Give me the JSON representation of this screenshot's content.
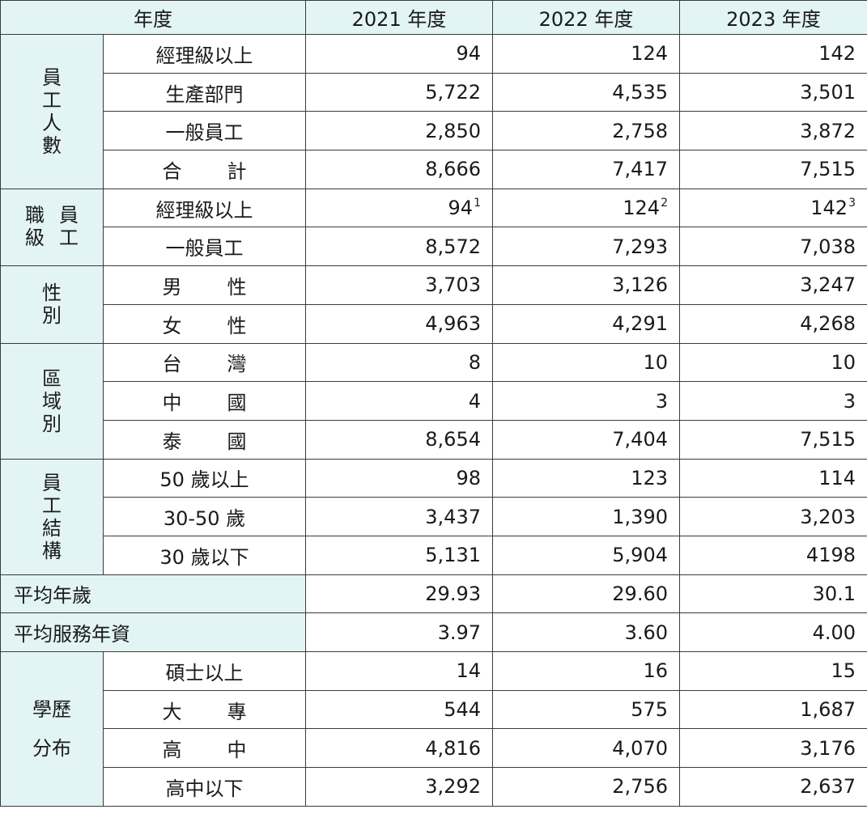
{
  "header": {
    "label": "年度",
    "y2021": "2021 年度",
    "y2022": "2022 年度",
    "y2023": "2023 年度"
  },
  "headcount": {
    "category": "員工人數",
    "rows": [
      {
        "label": "經理級以上",
        "v2021": "94",
        "v2022": "124",
        "v2023": "142"
      },
      {
        "label": "生產部門",
        "v2021": "5,722",
        "v2022": "4,535",
        "v2023": "3,501"
      },
      {
        "label": "一般員工",
        "v2021": "2,850",
        "v2022": "2,758",
        "v2023": "3,872"
      },
      {
        "label_a": "合",
        "label_b": "計",
        "v2021": "8,666",
        "v2022": "7,417",
        "v2023": "7,515"
      }
    ]
  },
  "job_level": {
    "category_col1": "職級",
    "category_col2": "員工",
    "rows": [
      {
        "label": "經理級以上",
        "v2021": "94",
        "v2021_sup": "1",
        "v2022": "124",
        "v2022_sup": "2",
        "v2023": "142",
        "v2023_sup": "3"
      },
      {
        "label": "一般員工",
        "v2021": "8,572",
        "v2022": "7,293",
        "v2023": "7,038"
      }
    ]
  },
  "gender": {
    "category": "性別",
    "rows": [
      {
        "label_a": "男",
        "label_b": "性",
        "v2021": "3,703",
        "v2022": "3,126",
        "v2023": "3,247"
      },
      {
        "label_a": "女",
        "label_b": "性",
        "v2021": "4,963",
        "v2022": "4,291",
        "v2023": "4,268"
      }
    ]
  },
  "region": {
    "category": "區域別",
    "rows": [
      {
        "label_a": "台",
        "label_b": "灣",
        "v2021": "8",
        "v2022": "10",
        "v2023": "10"
      },
      {
        "label_a": "中",
        "label_b": "國",
        "v2021": "4",
        "v2022": "3",
        "v2023": "3"
      },
      {
        "label_a": "泰",
        "label_b": "國",
        "v2021": "8,654",
        "v2022": "7,404",
        "v2023": "7,515"
      }
    ]
  },
  "age": {
    "category": "員工結構",
    "rows": [
      {
        "label": "50 歲以上",
        "v2021": "98",
        "v2022": "123",
        "v2023": "114"
      },
      {
        "label": "30-50 歲",
        "v2021": "3,437",
        "v2022": "1,390",
        "v2023": "3,203"
      },
      {
        "label": "30 歲以下",
        "v2021": "5,131",
        "v2022": "5,904",
        "v2023": "4198"
      }
    ]
  },
  "average_age": {
    "label": "平均年歲",
    "v2021": "29.93",
    "v2022": "29.60",
    "v2023": "30.1"
  },
  "average_tenure": {
    "label": "平均服務年資",
    "v2021": "3.97",
    "v2022": "3.60",
    "v2023": "4.00"
  },
  "education": {
    "category_line1": "學歷",
    "category_line2": "分布",
    "rows": [
      {
        "label": "碩士以上",
        "v2021": "14",
        "v2022": "16",
        "v2023": "15"
      },
      {
        "label_a": "大",
        "label_b": "專",
        "v2021": "544",
        "v2022": "575",
        "v2023": "1,687"
      },
      {
        "label_a": "高",
        "label_b": "中",
        "v2021": "4,816",
        "v2022": "4,070",
        "v2023": "3,176"
      },
      {
        "label": "高中以下",
        "v2021": "3,292",
        "v2022": "2,756",
        "v2023": "2,637"
      }
    ]
  }
}
